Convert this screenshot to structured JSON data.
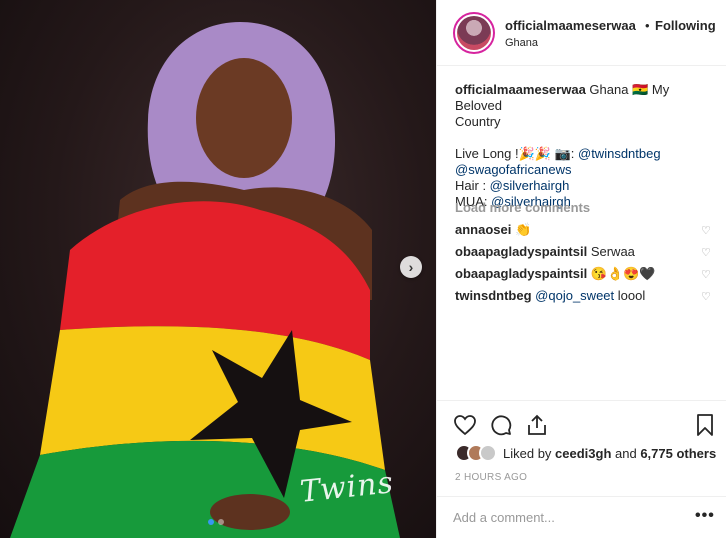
{
  "post": {
    "username": "officialmaameserwaa",
    "separator": "•",
    "follow_state": "Following",
    "location": "Ghana",
    "watermark": "Twins"
  },
  "caption": {
    "username": "officialmaameserwaa",
    "line1": "Ghana 🇬🇭 My Beloved",
    "line2": "Country",
    "live_long": "Live Long !🎉🎉 📷: ",
    "photo_credit": "@twinsdntbeg",
    "outlet": "@swagofafricanews",
    "hair_label": "Hair : ",
    "hair": "@silverhairgh",
    "mua_label": "MUA: ",
    "mua": "@silverhairgh"
  },
  "load_more": "Load more comments",
  "comments": [
    {
      "user": "annaosei",
      "text": "👏"
    },
    {
      "user": "obaapagladyspaintsil",
      "text": "Serwaa"
    },
    {
      "user": "obaapagladyspaintsil",
      "text": "😘👌😍🖤"
    },
    {
      "user": "twinsdntbeg",
      "mention": "@qojo_sweet",
      "text": " loool"
    }
  ],
  "likes": {
    "prefix": "Liked by ",
    "user": "ceedi3gh",
    "middle": " and ",
    "count": "6,775 others"
  },
  "timestamp": "2 HOURS AGO",
  "add_comment": {
    "placeholder": "Add a comment...",
    "more": "•••"
  },
  "icons": {
    "like": "heart-icon",
    "comment": "comment-icon",
    "share": "share-icon",
    "save": "bookmark-icon",
    "next": "chevron-right-icon"
  },
  "colors": {
    "link": "#003569",
    "story_ring": "#d6249f",
    "active_dot": "#3897f0"
  }
}
